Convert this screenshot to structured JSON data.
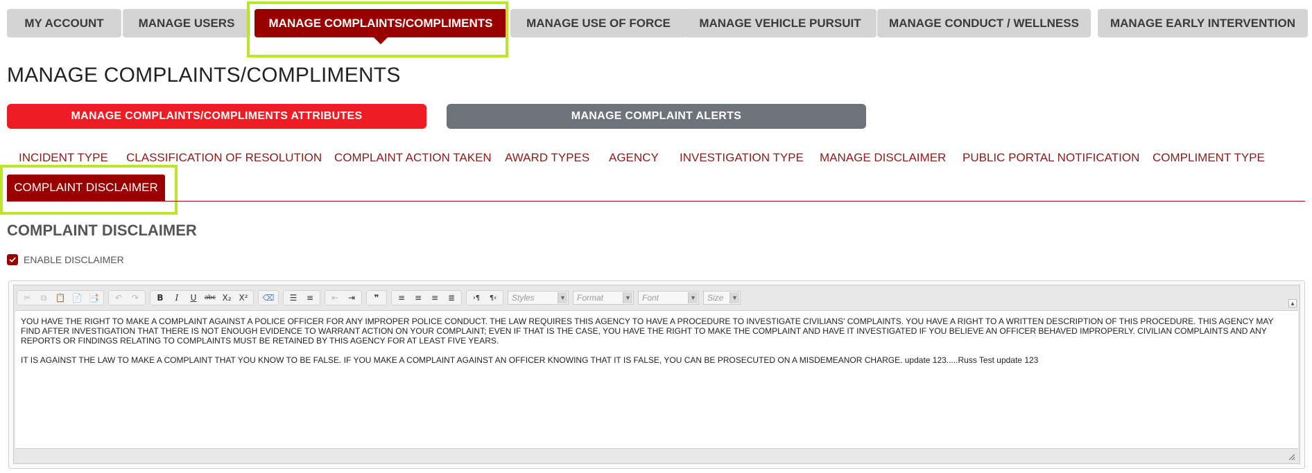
{
  "topnav": {
    "tabs": [
      {
        "label": "MY ACCOUNT"
      },
      {
        "label": "MANAGE USERS"
      },
      {
        "label": "MANAGE COMPLAINTS/COMPLIMENTS"
      },
      {
        "label": "MANAGE USE OF FORCE"
      },
      {
        "label": "MANAGE VEHICLE PURSUIT"
      },
      {
        "label": "MANAGE CONDUCT / WELLNESS"
      },
      {
        "label": "MANAGE EARLY INTERVENTION"
      }
    ],
    "active_tab": "MANAGE COMPLAINTS/COMPLIMENTS"
  },
  "page": {
    "title": "MANAGE COMPLAINTS/COMPLIMENTS"
  },
  "actions": {
    "attributes_label": "MANAGE COMPLAINTS/COMPLIMENTS ATTRIBUTES",
    "alerts_label": "MANAGE COMPLAINT ALERTS"
  },
  "subtabs": {
    "items": [
      {
        "label": "INCIDENT TYPE"
      },
      {
        "label": "CLASSIFICATION OF RESOLUTION"
      },
      {
        "label": "COMPLAINT ACTION TAKEN"
      },
      {
        "label": "AWARD TYPES"
      },
      {
        "label": "AGENCY"
      },
      {
        "label": "INVESTIGATION TYPE"
      },
      {
        "label": "MANAGE DISCLAIMER"
      },
      {
        "label": "PUBLIC PORTAL NOTIFICATION"
      },
      {
        "label": "COMPLIMENT TYPE"
      }
    ],
    "active_label": "COMPLAINT DISCLAIMER"
  },
  "section": {
    "title": "COMPLAINT DISCLAIMER",
    "enable_label": "ENABLE DISCLAIMER",
    "enable_checked": true
  },
  "editor": {
    "combos": {
      "styles": "Styles",
      "format": "Format",
      "font": "Font",
      "size": "Size"
    },
    "paragraphs": [
      "YOU HAVE THE RIGHT TO MAKE A COMPLAINT AGAINST A POLICE OFFICER FOR ANY IMPROPER POLICE CONDUCT. THE LAW REQUIRES THIS AGENCY TO HAVE A PROCEDURE TO INVESTIGATE CIVILIANS' COMPLAINTS. YOU HAVE A RIGHT TO A WRITTEN DESCRIPTION OF THIS PROCEDURE. THIS AGENCY MAY FIND AFTER INVESTIGATION THAT THERE IS NOT ENOUGH EVIDENCE TO WARRANT ACTION ON YOUR COMPLAINT; EVEN IF THAT IS THE CASE, YOU HAVE THE RIGHT TO MAKE THE COMPLAINT AND HAVE IT INVESTIGATED IF YOU BELIEVE AN OFFICER BEHAVED IMPROPERLY. CIVILIAN COMPLAINTS AND ANY REPORTS OR FINDINGS RELATING TO COMPLAINTS MUST BE RETAINED BY THIS AGENCY FOR AT LEAST FIVE YEARS.",
      "IT IS AGAINST THE LAW TO MAKE A COMPLAINT THAT YOU KNOW TO BE FALSE. IF YOU MAKE A COMPLAINT AGAINST AN OFFICER KNOWING THAT IT IS FALSE, YOU CAN BE PROSECUTED ON A MISDEMEANOR CHARGE. update 123.....Russ Test update 123"
    ]
  },
  "colors": {
    "accent_dark_red": "#9b0000",
    "accent_red": "#ee1c25",
    "gray_button": "#6d737a",
    "highlight_green": "#b9e62a"
  }
}
